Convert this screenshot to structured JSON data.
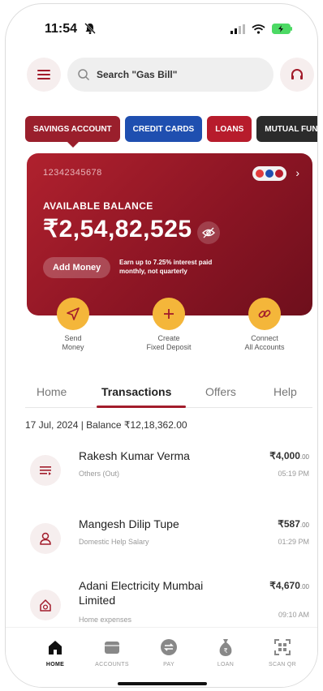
{
  "status_bar": {
    "time": "11:54"
  },
  "search": {
    "placeholder": "Search \"Gas Bill\""
  },
  "account_tabs": [
    "SAVINGS ACCOUNT",
    "CREDIT CARDS",
    "LOANS",
    "MUTUAL FUND"
  ],
  "card": {
    "account_number": "12342345678",
    "available_label": "AVAILABLE BALANCE",
    "balance": "₹2,54,82,525",
    "add_money": "Add Money",
    "promo": "Earn up to 7.25% interest paid monthly, not quarterly"
  },
  "quick_actions": [
    {
      "line1": "Send",
      "line2": "Money"
    },
    {
      "line1": "Create",
      "line2": "Fixed Deposit"
    },
    {
      "line1": "Connect",
      "line2": "All Accounts"
    }
  ],
  "section_tabs": [
    "Home",
    "Transactions",
    "Offers",
    "Help"
  ],
  "date_line": "17 Jul, 2024 | Balance ₹12,18,362.00",
  "transactions": [
    {
      "name": "Rakesh Kumar Verma",
      "category": "Others (Out)",
      "amount": "₹4,000",
      "paise": ".00",
      "time": "05:19 PM"
    },
    {
      "name": "Mangesh Dilip Tupe",
      "category": "Domestic Help Salary",
      "amount": "₹587",
      "paise": ".00",
      "time": "01:29 PM"
    },
    {
      "name": "Adani Electricity Mumbai Limited",
      "category": "Home expenses",
      "amount": "₹4,670",
      "paise": ".00",
      "time": "09:10 AM"
    }
  ],
  "bottom_nav": [
    "HOME",
    "ACCOUNTS",
    "PAY",
    "LOAN",
    "SCAN QR"
  ],
  "colors": {
    "brand": "#a21c2b",
    "accent": "#f4b63a",
    "credit": "#1f4fb0",
    "mutual": "#2b2b2b"
  }
}
